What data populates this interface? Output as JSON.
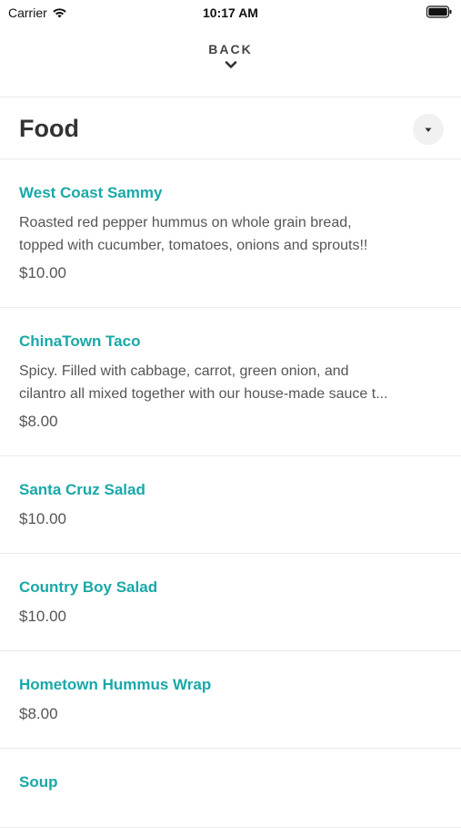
{
  "status_bar": {
    "carrier": "Carrier",
    "time": "10:17 AM",
    "icons": [
      "wifi-icon",
      "battery-icon"
    ]
  },
  "nav": {
    "back_label": "BACK",
    "back_icon": "chevron-down-icon"
  },
  "section": {
    "title": "Food",
    "dropdown_icon": "caret-down-icon"
  },
  "colors": {
    "accent": "#1aa8a8",
    "text": "#333333",
    "muted": "#555555",
    "divider": "#ececec"
  },
  "menu_items": [
    {
      "name": "West Coast Sammy",
      "description_lines": [
        "Roasted red pepper hummus on whole grain bread,",
        "topped with cucumber, tomatoes, onions and sprouts!!"
      ],
      "price": "$10.00"
    },
    {
      "name": "ChinaTown Taco",
      "description_lines": [
        "Spicy. Filled with cabbage, carrot, green onion, and",
        "cilantro all mixed together with our house-made sauce t..."
      ],
      "price": "$8.00"
    },
    {
      "name": "Santa Cruz Salad",
      "price": "$10.00"
    },
    {
      "name": "Country Boy Salad",
      "price": "$10.00"
    },
    {
      "name": "Hometown Hummus Wrap",
      "price": "$8.00"
    },
    {
      "name": "Soup",
      "price": ""
    }
  ]
}
